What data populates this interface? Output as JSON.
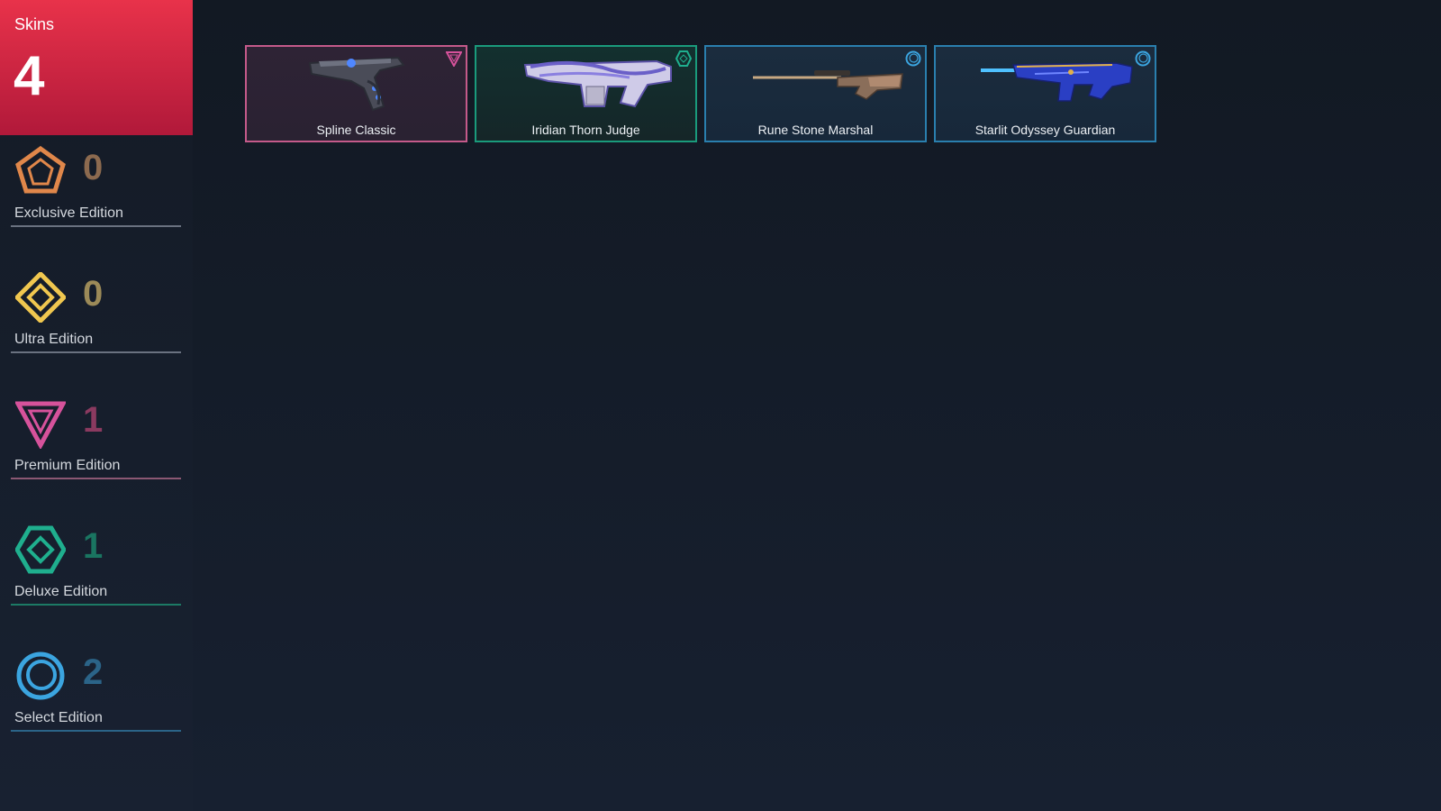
{
  "sidebar": {
    "total": {
      "title": "Skins",
      "count": "4"
    },
    "tiers": [
      {
        "label": "Exclusive Edition",
        "count": "0",
        "icon": "exclusive-edition-icon",
        "color": "#e0874a",
        "count_color": "#8c6a4f"
      },
      {
        "label": "Ultra Edition",
        "count": "0",
        "icon": "ultra-edition-icon",
        "color": "#f0c74f",
        "count_color": "#9c8a58"
      },
      {
        "label": "Premium Edition",
        "count": "1",
        "icon": "premium-edition-icon",
        "color": "#d6529b",
        "count_color": "#8b3a60"
      },
      {
        "label": "Deluxe Edition",
        "count": "1",
        "icon": "deluxe-edition-icon",
        "color": "#1faf8e",
        "count_color": "#1a7561"
      },
      {
        "label": "Select Edition",
        "count": "2",
        "icon": "select-edition-icon",
        "color": "#3ba5e0",
        "count_color": "#2b6488"
      }
    ]
  },
  "skins": [
    {
      "name": "Spline Classic",
      "tier": "Premium Edition",
      "icon": "premium-edition-icon",
      "border": "#c45a8a",
      "bg": "#2b2333"
    },
    {
      "name": "Iridian Thorn Judge",
      "tier": "Deluxe Edition",
      "icon": "deluxe-edition-icon",
      "border": "#1a9b7c",
      "bg": "#132b2d"
    },
    {
      "name": "Rune Stone Marshal",
      "tier": "Select Edition",
      "icon": "select-edition-icon",
      "border": "#2a7fae",
      "bg": "#17293a"
    },
    {
      "name": "Starlit Odyssey Guardian",
      "tier": "Select Edition",
      "icon": "select-edition-icon",
      "border": "#2a7fae",
      "bg": "#17293a"
    }
  ]
}
